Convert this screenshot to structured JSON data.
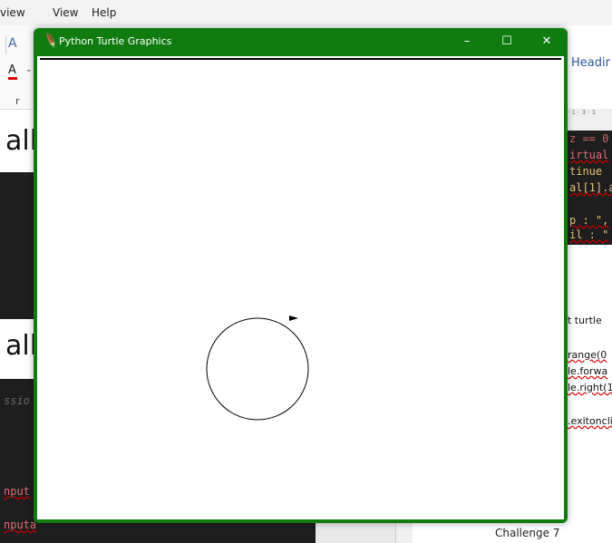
{
  "background": {
    "menu": [
      "view",
      "View",
      "Help"
    ],
    "heading_style": "Headir",
    "left_headings": [
      "all",
      "all"
    ],
    "left_code_fragments": [
      "ssio",
      "nput",
      "nputan):"
    ],
    "right_code_lines": [
      {
        "text": "z == 0",
        "color": "#cc6666"
      },
      {
        "text": "irtual",
        "color": "#e06c75"
      },
      {
        "text": "tinue",
        "color": "#e5c07b"
      },
      {
        "text": "al[1].a",
        "color": "#e5c07b"
      },
      {
        "text": "p : \",",
        "color": "#e5c07b"
      },
      {
        "text": "il : \"",
        "color": "#e5c07b"
      }
    ],
    "right_text_lines": [
      "t turtle",
      "range(0",
      "le.forwa",
      "le.right(1",
      ".exitoncli"
    ],
    "footer": "Challenge 7"
  },
  "turtle_window": {
    "title": "Python Turtle Graphics",
    "minimize": "–",
    "maximize": "☐",
    "close": "✕",
    "accent": "#107c10",
    "drawing": {
      "shape": "circle",
      "turtle_heading": "east"
    }
  }
}
